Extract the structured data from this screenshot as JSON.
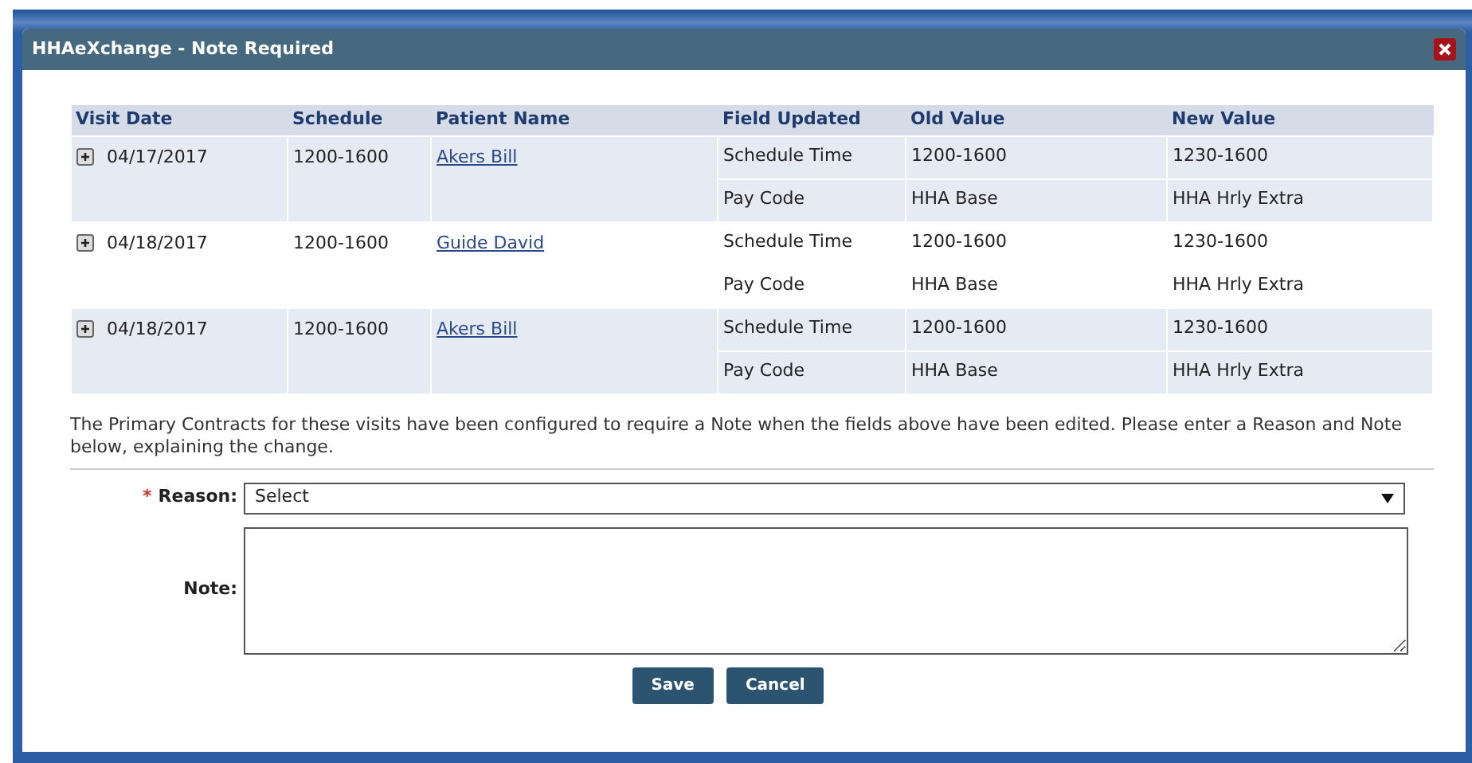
{
  "window": {
    "title": "HHAeXchange - Note Required"
  },
  "table": {
    "columns": [
      "Visit Date",
      "Schedule",
      "Patient Name",
      "Field Updated",
      "Old Value",
      "New Value"
    ],
    "visits": [
      {
        "date": "04/17/2017",
        "schedule": "1200-1600",
        "patient": "Akers Bill",
        "expanded": false,
        "changes": [
          {
            "field": "Schedule Time",
            "old": "1200-1600",
            "new": "1230-1600"
          },
          {
            "field": "Pay Code",
            "old": "HHA Base",
            "new": "HHA Hrly Extra"
          }
        ]
      },
      {
        "date": "04/18/2017",
        "schedule": "1200-1600",
        "patient": "Guide David",
        "expanded": false,
        "changes": [
          {
            "field": "Schedule Time",
            "old": "1200-1600",
            "new": "1230-1600"
          },
          {
            "field": "Pay Code",
            "old": "HHA Base",
            "new": "HHA Hrly Extra"
          }
        ]
      },
      {
        "date": "04/18/2017",
        "schedule": "1200-1600",
        "patient": "Akers Bill",
        "expanded": false,
        "changes": [
          {
            "field": "Schedule Time",
            "old": "1200-1600",
            "new": "1230-1600"
          },
          {
            "field": "Pay Code",
            "old": "HHA Base",
            "new": "HHA Hrly Extra"
          }
        ]
      }
    ]
  },
  "message": "The Primary Contracts for these visits have been configured to require a Note when the fields above have been edited. Please enter a Reason and Note below, explaining the change.",
  "form": {
    "reason": {
      "label": "Reason:",
      "required_mark": "*",
      "value": "Select"
    },
    "note": {
      "label": "Note:"
    }
  },
  "buttons": [
    "Save",
    "Cancel"
  ]
}
